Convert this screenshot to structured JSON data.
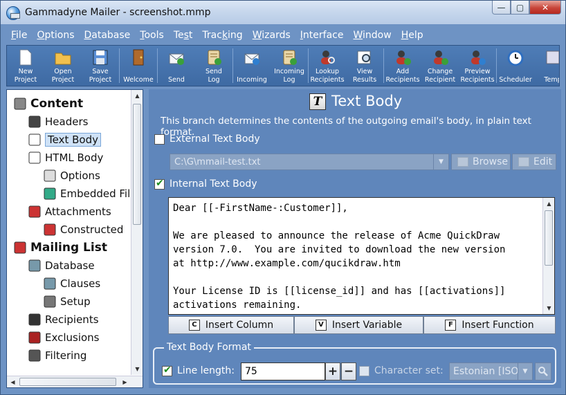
{
  "window": {
    "title": "Gammadyne Mailer - screenshot.mmp",
    "controls": {
      "minimize": "—",
      "maximize": "▢",
      "close": "✕"
    }
  },
  "menu": [
    {
      "label": "File",
      "key": "F",
      "rest": "ile"
    },
    {
      "label": "Options",
      "key": "O",
      "rest": "ptions"
    },
    {
      "label": "Database",
      "key": "D",
      "rest": "atabase"
    },
    {
      "label": "Tools",
      "key": "T",
      "rest": "ools"
    },
    {
      "label": "Test",
      "pre": "Te",
      "key": "s",
      "rest": "t"
    },
    {
      "label": "Tracking",
      "pre": "Trac",
      "key": "k",
      "rest": "ing"
    },
    {
      "label": "Wizards",
      "key": "W",
      "rest": "izards"
    },
    {
      "label": "Interface",
      "key": "I",
      "rest": "nterface"
    },
    {
      "label": "Window",
      "key": "W",
      "rest": "indow"
    },
    {
      "label": "Help",
      "key": "H",
      "rest": "elp"
    }
  ],
  "toolbar": [
    {
      "name": "new-project",
      "line1": "New",
      "line2": "Project",
      "icon": "new-project-icon"
    },
    {
      "name": "open-project",
      "line1": "Open",
      "line2": "Project",
      "icon": "open-folder-icon"
    },
    {
      "name": "save-project",
      "line1": "Save",
      "line2": "Project",
      "icon": "save-disk-icon"
    },
    {
      "name": "welcome",
      "line1": "",
      "line2": "Welcome",
      "icon": "door-icon"
    },
    {
      "name": "send",
      "line1": "",
      "line2": "Send",
      "icon": "send-envelope-icon"
    },
    {
      "name": "send-log",
      "line1": "Send",
      "line2": "Log",
      "icon": "send-log-icon"
    },
    {
      "name": "incoming",
      "line1": "",
      "line2": "Incoming",
      "icon": "incoming-envelope-icon"
    },
    {
      "name": "incoming-log",
      "line1": "Incoming",
      "line2": "Log",
      "icon": "incoming-log-icon"
    },
    {
      "name": "lookup-recipients",
      "line1": "Lookup",
      "line2": "Recipients",
      "icon": "lookup-recipients-icon"
    },
    {
      "name": "view-results",
      "line1": "View",
      "line2": "Results",
      "icon": "view-results-icon"
    },
    {
      "name": "add-recipients",
      "line1": "Add",
      "line2": "Recipients",
      "icon": "add-recipients-icon"
    },
    {
      "name": "change-recipient",
      "line1": "Change",
      "line2": "Recipient",
      "icon": "change-recipient-icon"
    },
    {
      "name": "preview-recipients",
      "line1": "Preview",
      "line2": "Recipients",
      "icon": "preview-recipients-icon"
    },
    {
      "name": "scheduler",
      "line1": "",
      "line2": "Scheduler",
      "icon": "clock-icon"
    },
    {
      "name": "templates",
      "line1": "",
      "line2": "Temp",
      "icon": "templates-icon"
    }
  ],
  "tree": [
    {
      "label": "Content",
      "level": 0,
      "bold": true,
      "icon": "content-page-icon"
    },
    {
      "label": "Headers",
      "level": 1,
      "icon": "headers-person-icon"
    },
    {
      "label": "Text Body",
      "level": 1,
      "selected": true,
      "icon": "text-body-icon"
    },
    {
      "label": "HTML Body",
      "level": 1,
      "icon": "html-body-icon"
    },
    {
      "label": "Options",
      "level": 2,
      "icon": "options-icon"
    },
    {
      "label": "Embedded Fil",
      "level": 2,
      "icon": "embedded-files-icon"
    },
    {
      "label": "Attachments",
      "level": 1,
      "icon": "attachments-icon"
    },
    {
      "label": "Constructed",
      "level": 2,
      "icon": "constructed-icon"
    },
    {
      "label": "Mailing List",
      "level": 0,
      "bold": true,
      "icon": "mailing-list-icon"
    },
    {
      "label": "Database",
      "level": 1,
      "icon": "database-icon"
    },
    {
      "label": "Clauses",
      "level": 2,
      "icon": "clauses-icon"
    },
    {
      "label": "Setup",
      "level": 2,
      "icon": "setup-icon"
    },
    {
      "label": "Recipients",
      "level": 1,
      "icon": "recipients-icon"
    },
    {
      "label": "Exclusions",
      "level": 1,
      "icon": "exclusions-icon"
    },
    {
      "label": "Filtering",
      "level": 1,
      "icon": "filtering-icon"
    }
  ],
  "panel": {
    "title": "Text Body",
    "title_icon_letter": "T",
    "description": "This branch determines the contents of the outgoing email's body, in plain text format.",
    "external": {
      "label": "External Text Body",
      "checked": false,
      "path_value": "C:\\G\\mmail-test.txt",
      "browse_label": "Browse",
      "edit_label": "Edit"
    },
    "internal": {
      "label": "Internal Text Body",
      "checked": true,
      "body": "Dear [[-FirstName-:Customer]],\n\nWe are pleased to announce the release of Acme QuickDraw\nversion 7.0.  You are invited to download the new version\nat http://www.example.com/qucikdraw.htm\n\nYour License ID is [[license_id]] and has [[activations]]\nactivations remaining."
    },
    "insert": [
      {
        "label": "Insert Column",
        "glyph": "C"
      },
      {
        "label": "Insert Variable",
        "glyph": "V"
      },
      {
        "label": "Insert Function",
        "glyph": "F"
      }
    ],
    "format": {
      "group_title": "Text Body Format",
      "line_length_label": "Line length:",
      "line_length_checked": true,
      "line_length_value": "75",
      "plus": "+",
      "minus": "−",
      "charset_label": "Character set:",
      "charset_checked": false,
      "charset_value": "Estonian [ISO-"
    }
  }
}
